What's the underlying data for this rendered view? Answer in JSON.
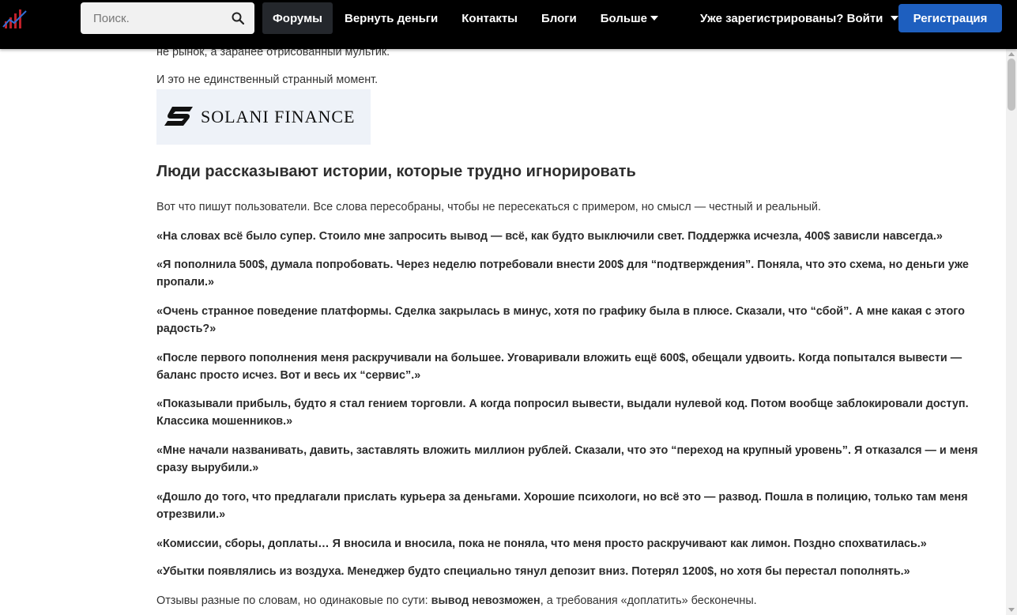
{
  "header": {
    "search": {
      "placeholder": "Поиск."
    },
    "nav": [
      "Форумы",
      "Вернуть деньги",
      "Контакты",
      "Блоги",
      "Больше"
    ],
    "login": "Уже зарегистрированы? Войти",
    "register": "Регистрация"
  },
  "article": {
    "cut_line": "не рынок, а заранее отрисованный мультик.",
    "intro": "И это не единственный странный момент.",
    "banner_text": "SOLANI FINANCE",
    "heading": "Люди рассказывают истории, которые трудно игнорировать",
    "lead": "Вот что пишут пользователи. Все слова пересобраны, чтобы не пересекаться с примером, но смысл — честный и реальный.",
    "quotes": [
      "«На словах всё было супер. Стоило мне запросить вывод — всё, как будто выключили свет. Поддержка исчезла, 400$ зависли навсегда.»",
      "«Я пополнила 500$, думала попробовать. Через неделю потребовали внести 200$ для “подтверждения”. Поняла, что это схема, но деньги уже пропали.»",
      "«Очень странное поведение платформы. Сделка закрылась в минус, хотя по графику была в плюсе. Сказали, что “сбой”. А мне какая с этого радость?»",
      "«После первого пополнения меня раскручивали на большее. Уговаривали вложить ещё 600$, обещали удвоить. Когда попытался вывести — баланс просто исчез. Вот и весь их “сервис”.»",
      "«Показывали прибыль, будто я стал гением торговли. А когда попросил вывести, выдали нулевой код. Потом вообще заблокировали доступ. Классика мошенников.»",
      "«Мне начали названивать, давить, заставлять вложить миллион рублей. Сказали, что это “переход на крупный уровень”. Я отказался — и меня сразу вырубили.»",
      "«Дошло до того, что предлагали прислать курьера за деньгами. Хорошие психологи, но всё это — развод. Пошла в полицию, только там меня отрезвили.»",
      "«Комиссии, сборы, доплаты… Я вносила и вносила, пока не поняла, что меня просто раскручивают как лимон. Поздно спохватилась.»",
      "«Убытки появлялись из воздуха. Менеджер будто специально тянул депозит вниз. Потерял 1200$, но хотя бы перестал пополнять.»"
    ],
    "closing": {
      "before": "Отзывы разные по словам, но одинаковые по сути: ",
      "bold": "вывод невозможен",
      "after": ", а требования «доплатить» бесконечны."
    }
  },
  "colors": {
    "topbar": "#000000",
    "register": "#1e5fbf",
    "active_tab": "#24272c",
    "banner_bg": "#eef2f8"
  }
}
